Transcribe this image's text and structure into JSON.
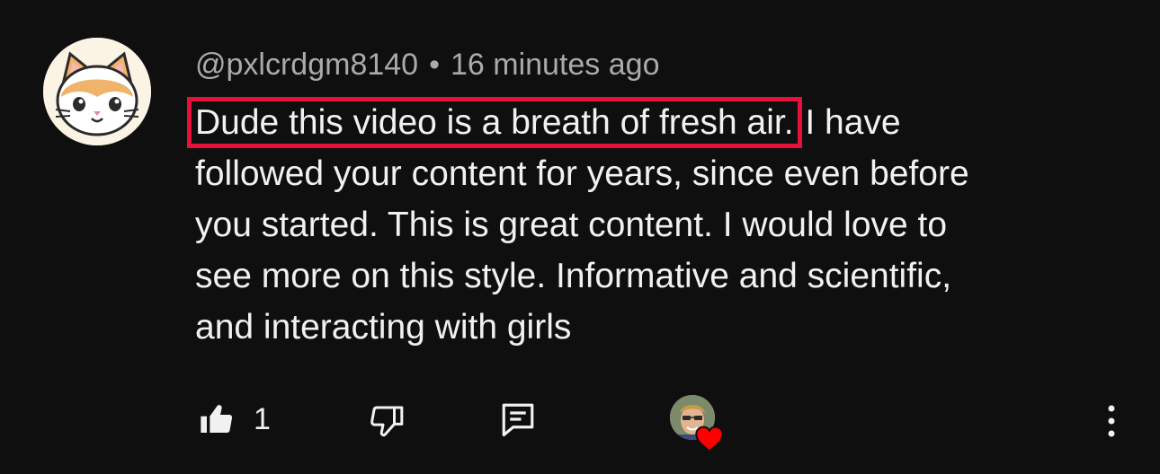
{
  "comment": {
    "author": "@pxlcrdgm8140",
    "separator": "•",
    "timestamp": "16 minutes ago",
    "highlighted_text": "Dude this video is a breath of fresh air.",
    "lines": [
      " I have",
      "followed your content for years, since even before",
      "you started. This is great content. I would love to",
      "see more on this style. Informative and scientific,",
      "and interacting with girls"
    ],
    "highlight_color": "#e8103a"
  },
  "actions": {
    "like_count": "1",
    "like_icon": "thumbs-up-filled-icon",
    "dislike_icon": "thumbs-down-outline-icon",
    "reply_icon": "comment-reply-icon",
    "creator_heart_icon": "heart-icon",
    "more_icon": "vertical-ellipsis-icon",
    "heart_color": "#ff0000"
  }
}
